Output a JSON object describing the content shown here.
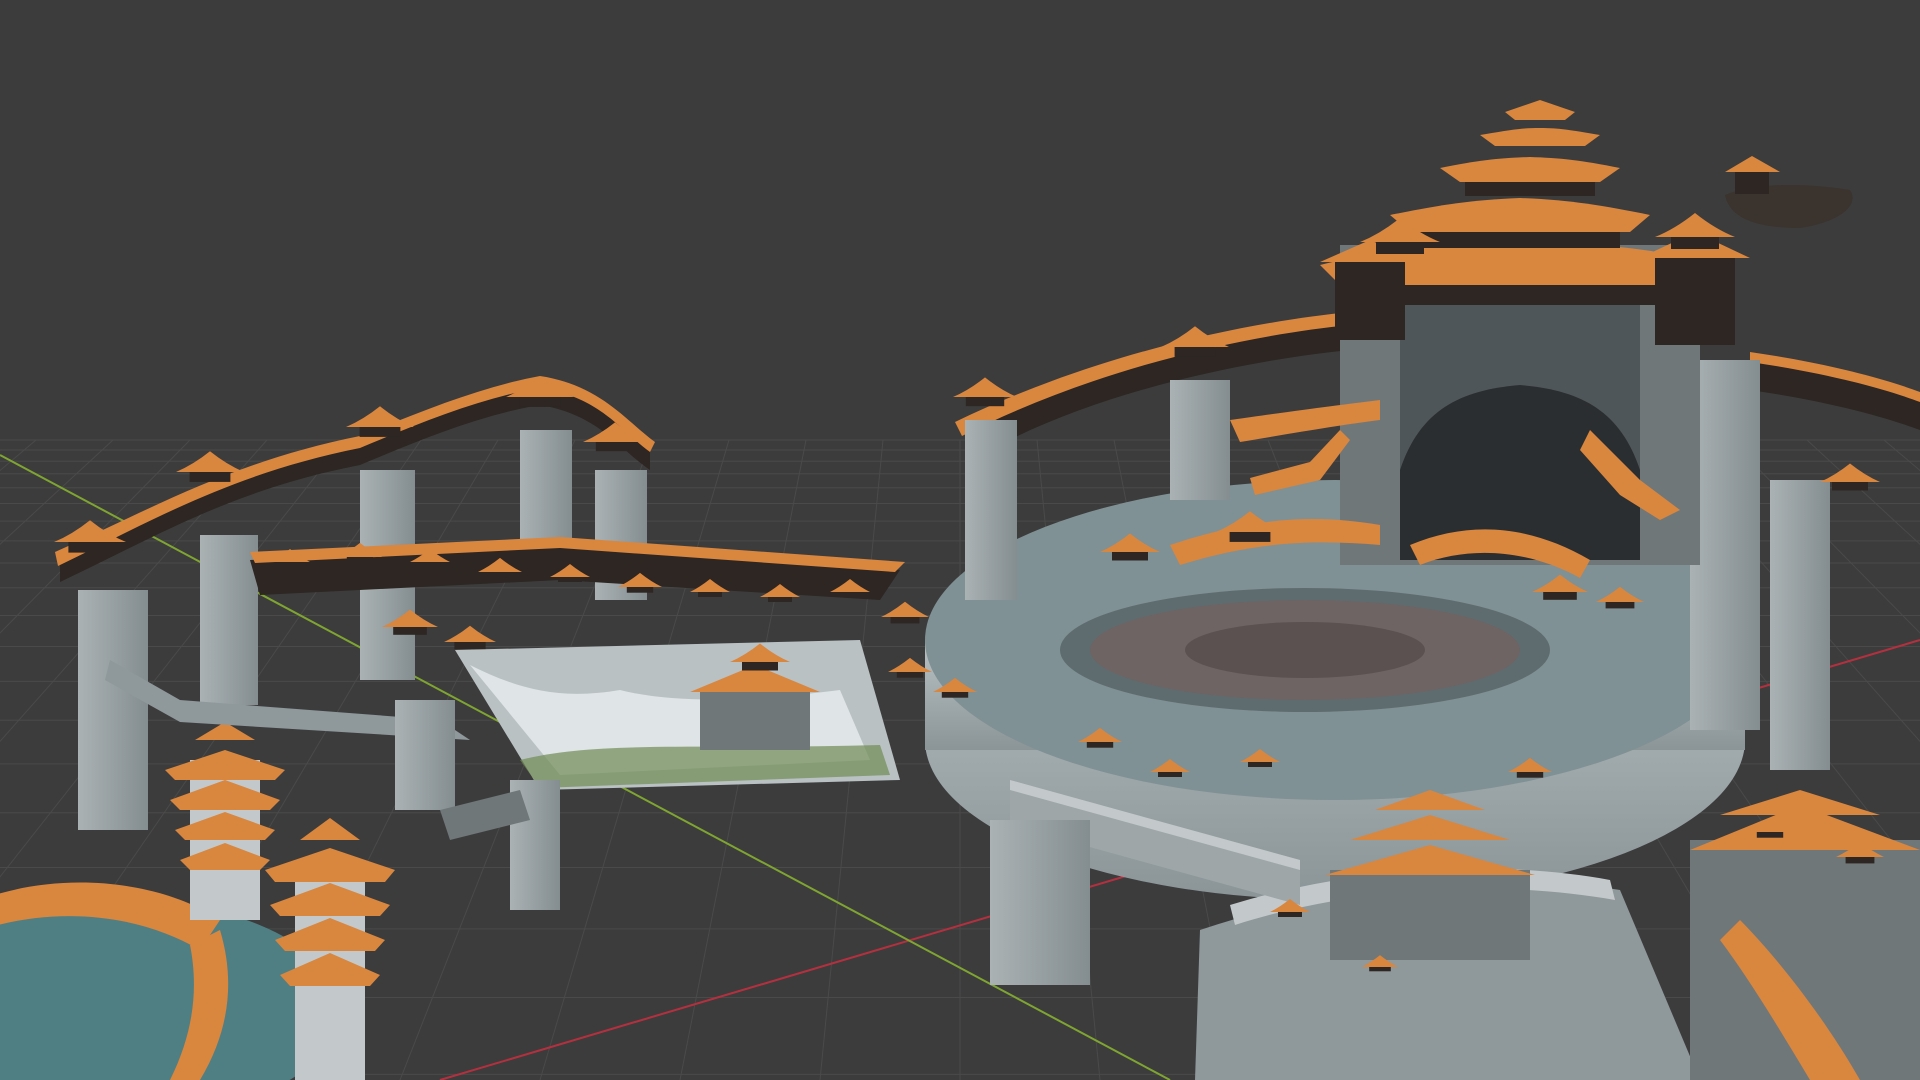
{
  "app": {
    "kind": "3D viewport",
    "mode": "solid shading"
  },
  "colors": {
    "background": "#3c3c3c",
    "grid_line": "#4a4a4a",
    "axis_x": "#b5303f",
    "axis_y": "#7fa531",
    "roof": "#d9863f",
    "roof_dark": "#9a5624",
    "wall": "#9ea6a8",
    "wall_dark": "#6f7779",
    "wall_light": "#c3c9ca",
    "platform_top": "#7f9194",
    "platform_ring": "#5e6c6f",
    "snow": "#dfe4e6",
    "timber": "#2d2622",
    "water": "#4f7f83",
    "grass": "#6f8c54"
  },
  "icons": {
    "axis_x": "x-axis-line",
    "axis_y": "y-axis-line"
  }
}
